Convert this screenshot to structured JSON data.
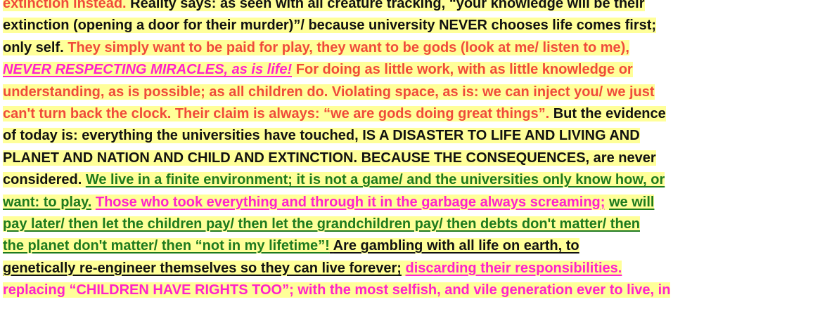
{
  "colors": {
    "highlight": "#ffff99",
    "red": "#f04b3a",
    "black": "#111111",
    "magenta": "#ff22cc",
    "green": "#1e7a1e"
  },
  "lines": [
    [
      {
        "text": "extinction instead. ",
        "color": "red",
        "u": false,
        "i": false
      },
      {
        "text": "Reality says:  as seen with all creature tracking, “your knowledge will be their",
        "color": "black",
        "u": false,
        "i": false
      }
    ],
    [
      {
        "text": "extinction (opening a door for their murder)”/ because university NEVER chooses life comes first;",
        "color": "black",
        "u": false,
        "i": false
      }
    ],
    [
      {
        "text": "only self. ",
        "color": "black",
        "u": false,
        "i": false
      },
      {
        "text": "They simply want to be paid for play, they want to be gods (look at me/ listen to me),",
        "color": "red",
        "u": false,
        "i": false
      },
      {
        "text": " ",
        "color": "red",
        "u": true,
        "i": false
      }
    ],
    [
      {
        "text": "NEVER RESPECTING  MIRACLES, as is life!",
        "color": "magenta",
        "u": true,
        "i": true
      },
      {
        "text": "  For doing as little work, with as little knowledge or",
        "color": "red",
        "u": false,
        "i": false
      }
    ],
    [
      {
        "text": "understanding, as is possible; as all children do. Violating space, as is: we can inject you/ we just",
        "color": "red",
        "u": false,
        "i": false
      }
    ],
    [
      {
        "text": "can't turn back the clock.  Their claim is always: “we are gods doing great things”.  ",
        "color": "red",
        "u": false,
        "i": false
      },
      {
        "text": "But the evidence",
        "color": "black",
        "u": false,
        "i": false
      }
    ],
    [
      {
        "text": "of today is:  everything the universities have touched, IS A DISASTER TO LIFE AND LIVING AND",
        "color": "black",
        "u": false,
        "i": false
      }
    ],
    [
      {
        "text": "PLANET AND NATION AND CHILD AND EXTINCTION.  BECAUSE THE CONSEQUENCES, are never",
        "color": "black",
        "u": false,
        "i": false
      }
    ],
    [
      {
        "text": "considered. ",
        "color": "black",
        "u": false,
        "i": false
      },
      {
        "text": "We live in a finite environment; it is not a game/ and the universities only know how, or",
        "color": "green",
        "u": true,
        "i": false
      }
    ],
    [
      {
        "text": "want: to play.",
        "color": "green",
        "u": true,
        "i": false
      },
      {
        "text": " ",
        "color": "black",
        "u": false,
        "i": false
      },
      {
        "text": "Those who took everything and through it in the garbage always screaming;",
        "color": "magenta",
        "u": true,
        "i": false
      },
      {
        "text": " ",
        "color": "black",
        "u": false,
        "i": false
      },
      {
        "text": "we will",
        "color": "green",
        "u": true,
        "i": false
      }
    ],
    [
      {
        "text": "pay later/ then let the children pay/ then let the grandchildren pay/ then debts don't matter/ then",
        "color": "green",
        "u": true,
        "i": false
      }
    ],
    [
      {
        "text": "the planet don't matter/ then “not in my lifetime”!",
        "color": "green",
        "u": true,
        "i": false
      },
      {
        "text": "   ",
        "color": "black",
        "u": true,
        "i": false
      },
      {
        "text": "Are gambling with all life on earth, to",
        "color": "black",
        "u": true,
        "i": false
      }
    ],
    [
      {
        "text": "genetically re-engineer themselves so they can live forever;",
        "color": "black",
        "u": true,
        "i": false
      },
      {
        "text": "  ",
        "color": "black",
        "u": false,
        "i": false
      },
      {
        "text": "discarding their responsibilities. ",
        "color": "magenta",
        "u": true,
        "i": false
      }
    ],
    [
      {
        "text": "replacing “CHILDREN HAVE RIGHTS TOO”; with the most selfish, and vile generation ever to live, in",
        "color": "magenta",
        "u": false,
        "i": false
      }
    ]
  ]
}
